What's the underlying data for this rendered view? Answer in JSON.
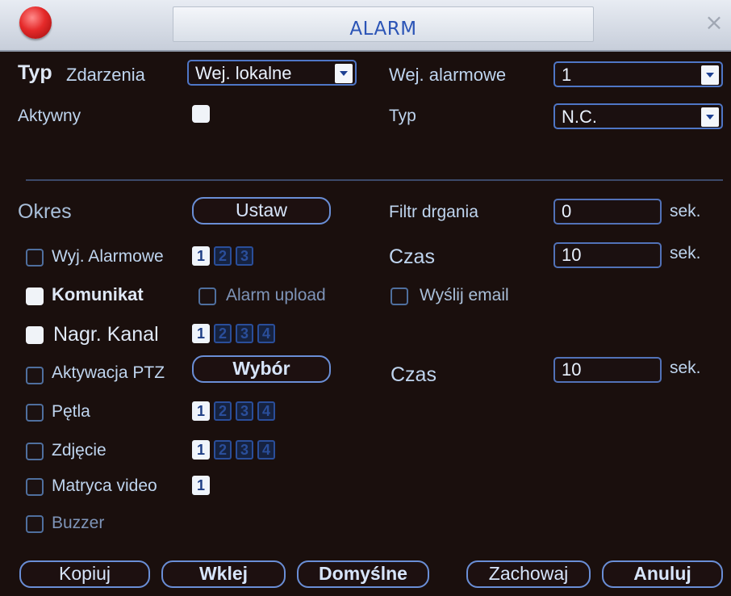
{
  "titlebar": {
    "title": "ALARM",
    "close_symbol": "×",
    "logo_icon": "red-dot-logo-icon"
  },
  "fields": {
    "typ_prefix": "Typ",
    "typ_label": "Zdarzenia",
    "typ_value": "Wej. lokalne",
    "wej_label": "Wej. alarmowe",
    "wej_value": "1",
    "aktywny_label": "Aktywny",
    "typ2_label": "Typ",
    "typ2_value": "N.C."
  },
  "section": {
    "okres_label": "Okres",
    "ustaw_btn": "Ustaw",
    "filtr_label": "Filtr drgania",
    "filtr_value": "0",
    "filtr_unit": "sek.",
    "czas1_label": "Czas",
    "czas1_value": "10",
    "czas1_unit": "sek.",
    "wyj_label": "Wyj. Alarmowe",
    "wyj_nums": [
      "1",
      "2",
      "3"
    ],
    "komunikat_label": "Komunikat",
    "alarm_upload_label": "Alarm upload",
    "email_label": "Wyślij email",
    "nagr_label": "Nagr. Kanal",
    "nagr_nums": [
      "1",
      "2",
      "3",
      "4"
    ],
    "ptz_label": "Aktywacja PTZ",
    "wybor_btn": "Wybór",
    "czas2_label": "Czas",
    "czas2_value": "10",
    "czas2_unit": "sek.",
    "petla_label": "Pętla",
    "petla_nums": [
      "1",
      "2",
      "3",
      "4"
    ],
    "zdjecie_label": "Zdjęcie",
    "zdjecie_nums": [
      "1",
      "2",
      "3",
      "4"
    ],
    "matryca_label": "Matryca video",
    "matryca_nums": [
      "1"
    ],
    "buzzer_label": "Buzzer"
  },
  "footer": {
    "kopiuj": "Kopiuj",
    "wklej": "Wklej",
    "domyslne": "Domyślne",
    "zachowaj": "Zachowaj",
    "anuluj": "Anuluj"
  }
}
